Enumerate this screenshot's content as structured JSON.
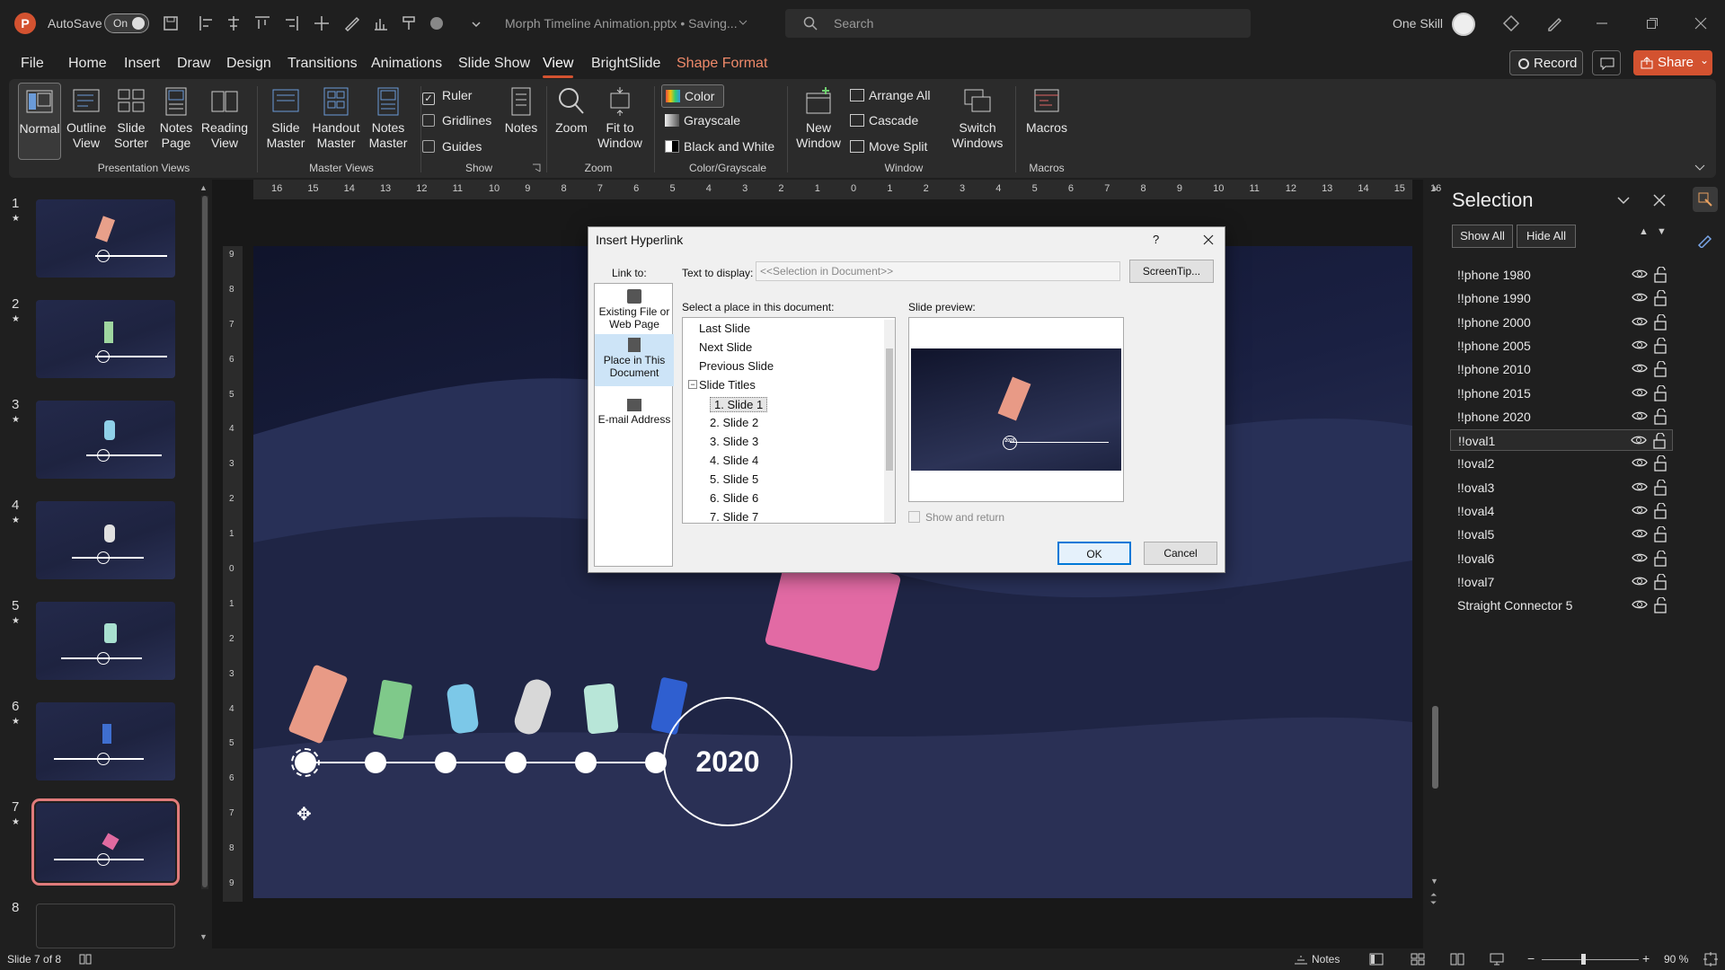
{
  "titlebar": {
    "autosave_label": "AutoSave",
    "autosave_state": "On",
    "doc_title": "Morph Timeline Animation.pptx • Saving...",
    "search_placeholder": "Search",
    "user_name": "One Skill"
  },
  "menu": {
    "tabs": [
      "File",
      "Home",
      "Insert",
      "Draw",
      "Design",
      "Transitions",
      "Animations",
      "Slide Show",
      "View",
      "BrightSlide",
      "Shape Format"
    ],
    "active": "View",
    "record": "Record",
    "share": "Share"
  },
  "ribbon": {
    "normal": "Normal",
    "outline": "Outline View",
    "sorter": "Slide Sorter",
    "notes_page": "Notes Page",
    "reading": "Reading View",
    "g_presentation": "Presentation Views",
    "slide_master": "Slide Master",
    "handout_master": "Handout Master",
    "notes_master": "Notes Master",
    "g_master": "Master Views",
    "ruler": "Ruler",
    "gridlines": "Gridlines",
    "guides": "Guides",
    "notes": "Notes",
    "g_show": "Show",
    "zoom": "Zoom",
    "fit": "Fit to Window",
    "g_zoom": "Zoom",
    "color": "Color",
    "grayscale": "Grayscale",
    "bw": "Black and White",
    "g_color": "Color/Grayscale",
    "new_window": "New Window",
    "arrange_all": "Arrange All",
    "cascade": "Cascade",
    "move_split": "Move Split",
    "switch": "Switch Windows",
    "g_window": "Window",
    "macros": "Macros",
    "g_macros": "Macros"
  },
  "thumbs": [
    "1",
    "2",
    "3",
    "4",
    "5",
    "6",
    "7",
    "8"
  ],
  "ruler": {
    "h": [
      "16",
      "15",
      "14",
      "13",
      "12",
      "11",
      "10",
      "9",
      "8",
      "7",
      "6",
      "5",
      "4",
      "3",
      "2",
      "1",
      "0",
      "1",
      "2",
      "3",
      "4",
      "5",
      "6",
      "7",
      "8",
      "9",
      "10",
      "11",
      "12",
      "13",
      "14",
      "15",
      "16"
    ],
    "v": [
      "9",
      "8",
      "7",
      "6",
      "5",
      "4",
      "3",
      "2",
      "1",
      "0",
      "1",
      "2",
      "3",
      "4",
      "5",
      "6",
      "7",
      "8",
      "9"
    ]
  },
  "slide": {
    "year": "2020"
  },
  "dialog": {
    "title": "Insert Hyperlink",
    "help": "?",
    "link_to": "Link to:",
    "text_to_display": "Text to display:",
    "text_value": "<<Selection in Document>>",
    "screentip": "ScreenTip...",
    "opt_file": "Existing File or Web Page",
    "opt_place": "Place in This Document",
    "opt_email": "E-mail Address",
    "select_place": "Select a place in this document:",
    "slide_preview": "Slide preview:",
    "items": [
      "Last Slide",
      "Next Slide",
      "Previous Slide",
      "Slide Titles",
      "1. Slide 1",
      "2. Slide 2",
      "3. Slide 3",
      "4. Slide 4",
      "5. Slide 5",
      "6. Slide 6",
      "7. Slide 7"
    ],
    "show_return": "Show and return",
    "ok": "OK",
    "cancel": "Cancel",
    "preview_year": "2020"
  },
  "selection": {
    "title": "Selection",
    "show_all": "Show All",
    "hide_all": "Hide All",
    "items": [
      "!!phone 1980",
      "!!phone 1990",
      "!!phone 2000",
      "!!phone 2005",
      "!!phone 2010",
      "!!phone 2015",
      "!!phone 2020",
      "!!oval1",
      "!!oval2",
      "!!oval3",
      "!!oval4",
      "!!oval5",
      "!!oval6",
      "!!oval7",
      "Straight Connector 5"
    ],
    "selected_index": 7
  },
  "status": {
    "slide": "Slide 7 of 8",
    "notes": "Notes",
    "zoom": "90 %"
  }
}
